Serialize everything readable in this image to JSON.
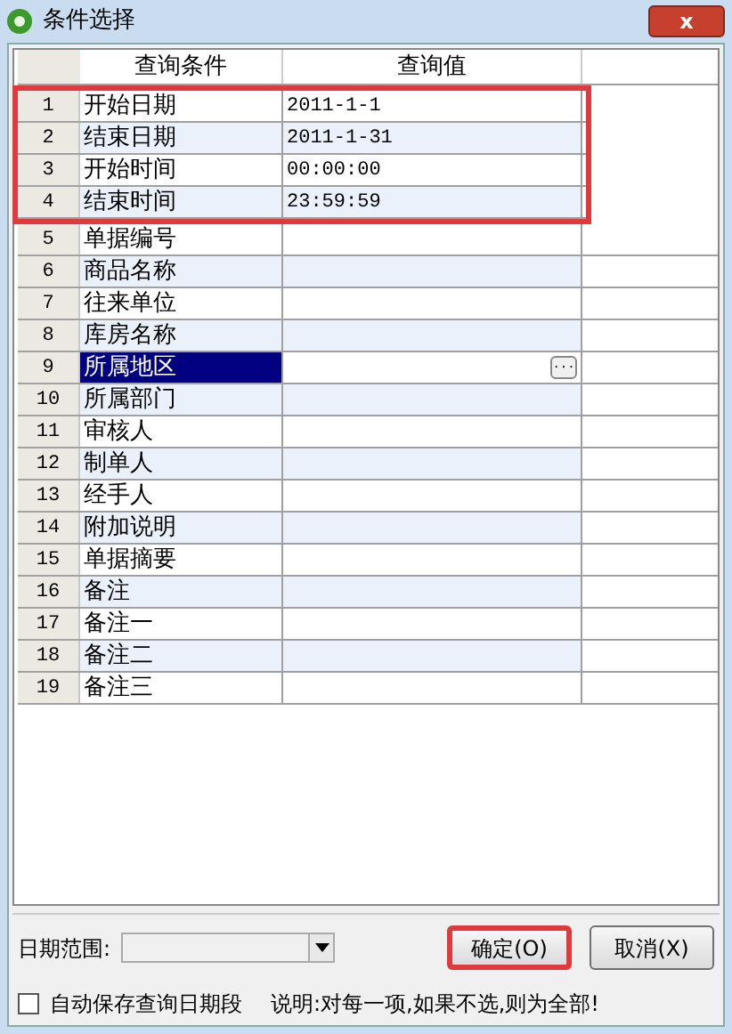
{
  "window": {
    "title": "条件选择",
    "close": "x"
  },
  "table": {
    "columns": [
      "查询条件",
      "查询值"
    ],
    "rows": [
      {
        "index": "1",
        "condition": "开始日期",
        "value": "2011-1-1",
        "selected": false,
        "highlighted": true
      },
      {
        "index": "2",
        "condition": "结束日期",
        "value": "2011-1-31",
        "selected": false,
        "highlighted": true
      },
      {
        "index": "3",
        "condition": "开始时间",
        "value": "00:00:00",
        "selected": false,
        "highlighted": true
      },
      {
        "index": "4",
        "condition": "结束时间",
        "value": "23:59:59",
        "selected": false,
        "highlighted": true
      },
      {
        "index": "5",
        "condition": "单据编号",
        "selected": false,
        "highlighted": false
      },
      {
        "index": "6",
        "condition": "商品名称",
        "selected": false,
        "highlighted": false
      },
      {
        "index": "7",
        "condition": "往来单位",
        "selected": false,
        "highlighted": false
      },
      {
        "index": "8",
        "condition": "库房名称",
        "selected": false,
        "highlighted": false
      },
      {
        "index": "9",
        "condition": "所属地区",
        "selected": true,
        "highlighted": false,
        "browse": "···"
      },
      {
        "index": "10",
        "condition": "所属部门",
        "selected": false,
        "highlighted": false
      },
      {
        "index": "11",
        "condition": "审核人",
        "selected": false,
        "highlighted": false
      },
      {
        "index": "12",
        "condition": "制单人",
        "selected": false,
        "highlighted": false
      },
      {
        "index": "13",
        "condition": "经手人",
        "selected": false,
        "highlighted": false
      },
      {
        "index": "14",
        "condition": "附加说明",
        "selected": false,
        "highlighted": false
      },
      {
        "index": "15",
        "condition": "单据摘要",
        "selected": false,
        "highlighted": false
      },
      {
        "index": "16",
        "condition": "备注",
        "selected": false,
        "highlighted": false
      },
      {
        "index": "17",
        "condition": "备注一",
        "selected": false,
        "highlighted": false
      },
      {
        "index": "18",
        "condition": "备注二",
        "selected": false,
        "highlighted": false
      },
      {
        "index": "19",
        "condition": "备注三",
        "selected": false,
        "highlighted": false
      }
    ]
  },
  "date_range": {
    "label": "日期范围:"
  },
  "buttons": [
    {
      "label": "确定(O)",
      "highlighted": true
    },
    {
      "label": "取消(X)",
      "highlighted": false
    }
  ],
  "auto_save": {
    "label": "自动保存查询日期段",
    "checked": false
  },
  "note": "说明:对每一项,如果不选,则为全部!"
}
